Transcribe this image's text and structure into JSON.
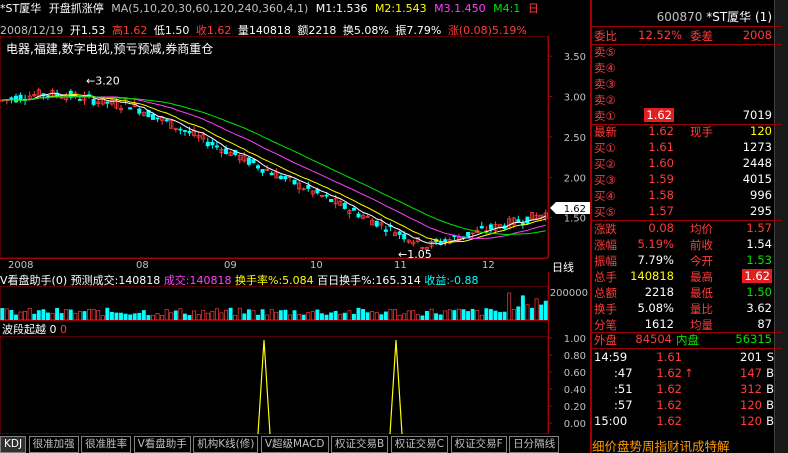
{
  "header": {
    "name": "*ST厦华",
    "indicator": "开盘抓涨停",
    "ma_label": "MA(5,10,20,30,60,120,240,360,4,1)",
    "m1": "M1:1.536",
    "m2": "M2:1.543",
    "m3": "M3.1.450",
    "m4": "M4:1",
    "m4_tail": "日"
  },
  "date_row": {
    "date": "2008/12/19",
    "open": "开1.53",
    "high": "高1.62",
    "low": "低1.50",
    "close": "收1.62",
    "volume": "量140818",
    "amount": "额2218",
    "turnover": "换5.08%",
    "amplitude": "振7.79%",
    "change": "涨(0.08)5.19%"
  },
  "concept": "电器,福建,数字电视,预亏预减,券商重仓",
  "price_axis": [
    "3.50",
    "3.00",
    "2.50",
    "2.00",
    "1.50"
  ],
  "current_price_tag": "1.62",
  "high_mark": "3.20",
  "low_mark": "1.05",
  "time_axis": [
    "2008",
    "08",
    "09",
    "10",
    "11",
    "12"
  ],
  "time_axis_unit": "日线",
  "volume_header": {
    "name": "V看盘助手(0)",
    "forecast": "预测成交:140818",
    "volume": "成交:140818",
    "turnover": "换手率%:5.084",
    "hundred": "百日换手%:165.314",
    "tail": "收益:-0.88"
  },
  "volume_axis": [
    "200000"
  ],
  "osc_header": {
    "name": "波段起越",
    "v1": "0",
    "v2": "0"
  },
  "osc_axis": [
    "1.00",
    "0.80",
    "0.60",
    "0.40",
    "0.20",
    "0.00"
  ],
  "tabs": [
    "KDJ",
    "很准加强",
    "很准胜率",
    "V看盘助手",
    "机构K线(修)",
    "V超级MACD",
    "权证交易B",
    "权证交易C",
    "权证交易F",
    "日分隔线"
  ],
  "right_panel": {
    "code": "600870",
    "name": "*ST厦华",
    "num": "(1)",
    "wei_bi_label": "委比",
    "wei_bi": "12.52%",
    "wei_cha_label": "委差",
    "wei_cha": "2008",
    "sell": [
      {
        "label": "卖⑤",
        "price": "",
        "vol": ""
      },
      {
        "label": "卖④",
        "price": "",
        "vol": ""
      },
      {
        "label": "卖③",
        "price": "",
        "vol": ""
      },
      {
        "label": "卖②",
        "price": "",
        "vol": ""
      },
      {
        "label": "卖①",
        "price": "1.62",
        "vol": "7019"
      }
    ],
    "latest_label": "最新",
    "latest": "1.62",
    "now_hand_label": "现手",
    "now_hand": "120",
    "buy": [
      {
        "label": "买①",
        "price": "1.61",
        "vol": "1273"
      },
      {
        "label": "买②",
        "price": "1.60",
        "vol": "2448"
      },
      {
        "label": "买③",
        "price": "1.59",
        "vol": "4015"
      },
      {
        "label": "买④",
        "price": "1.58",
        "vol": "996"
      },
      {
        "label": "买⑤",
        "price": "1.57",
        "vol": "295"
      }
    ],
    "stats": [
      {
        "l1": "涨跌",
        "v1": "0.08",
        "l2": "均价",
        "v2": "1.57"
      },
      {
        "l1": "涨幅",
        "v1": "5.19%",
        "l2": "前收",
        "v2": "1.54"
      },
      {
        "l1": "振幅",
        "v1": "7.79%",
        "l2": "今开",
        "v2": "1.53"
      },
      {
        "l1": "总手",
        "v1": "140818",
        "l2": "最高",
        "v2": "1.62"
      },
      {
        "l1": "总额",
        "v1": "2218",
        "l2": "最低",
        "v2": "1.50"
      },
      {
        "l1": "换手",
        "v1": "5.08%",
        "l2": "量比",
        "v2": "3.62"
      },
      {
        "l1": "分笔",
        "v1": "1612",
        "l2": "均量",
        "v2": "87"
      }
    ],
    "outer_label": "外盘",
    "outer": "84504",
    "inner_label": "内盘",
    "inner": "56315",
    "ticks": [
      {
        "time": "14:59",
        "price": "1.61",
        "arrow": "",
        "vol": "201",
        "side": "S"
      },
      {
        "time": ":47",
        "price": "1.62",
        "arrow": "↑",
        "vol": "147",
        "side": "B"
      },
      {
        "time": ":51",
        "price": "1.62",
        "arrow": "",
        "vol": "312",
        "side": "B"
      },
      {
        "time": ":57",
        "price": "1.62",
        "arrow": "",
        "vol": "120",
        "side": "B"
      },
      {
        "time": "15:00",
        "price": "1.62",
        "arrow": "",
        "vol": "120",
        "side": "B"
      }
    ],
    "bottom_tabs": "细价盘势周指财讯成特解"
  },
  "colors": {
    "up": "#ff3c3c",
    "down": "#00e600",
    "frame": "#a00000",
    "ma_white": "#ffffff",
    "ma_yellow": "#ffff00",
    "ma_magenta": "#ff40ff",
    "ma_green": "#00e600"
  }
}
